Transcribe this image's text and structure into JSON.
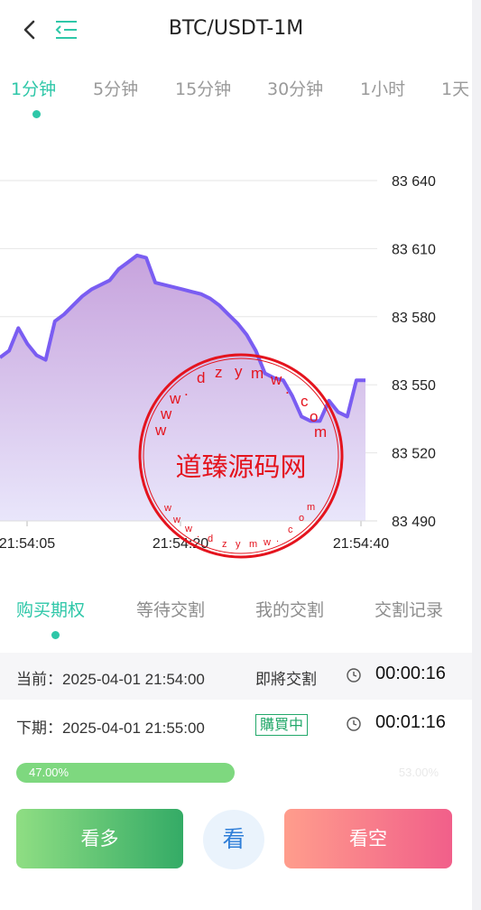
{
  "header": {
    "title": "BTC/USDT-1M",
    "back_icon": "chevron-left-icon",
    "menu_icon": "menu-indent-icon"
  },
  "timeframe_tabs": [
    {
      "label": "1分钟",
      "active": true
    },
    {
      "label": "5分钟",
      "active": false
    },
    {
      "label": "15分钟",
      "active": false
    },
    {
      "label": "30分钟",
      "active": false
    },
    {
      "label": "1小时",
      "active": false
    },
    {
      "label": "1天",
      "active": false
    }
  ],
  "chart_data": {
    "type": "area",
    "title": "",
    "xlabel": "",
    "ylabel": "",
    "y_ticks": [
      "83 640",
      "83 610",
      "83 580",
      "83 550",
      "83 520",
      "83 490"
    ],
    "x_ticks": [
      "21:54:05",
      "21:54:20",
      "21:54:40"
    ],
    "ylim": [
      83490,
      83640
    ],
    "axis_position": "right",
    "grid": true,
    "line_color": "#7a5df2",
    "fill_color_top": "#c7a3dd",
    "fill_color_bottom": "#e9e6fb",
    "series": [
      {
        "x": [
          0,
          1,
          2,
          3,
          4,
          5,
          6,
          7,
          8,
          9,
          10,
          11,
          12,
          13,
          14,
          15,
          16,
          17,
          18,
          19,
          20,
          21,
          22,
          23,
          24,
          25,
          26,
          27,
          28,
          29,
          30,
          31,
          32,
          33,
          34,
          35,
          36,
          37,
          38,
          39,
          40
        ],
        "values": [
          83562,
          83565,
          83575,
          83568,
          83563,
          83561,
          83578,
          83581,
          83585,
          83589,
          83592,
          83594,
          83596,
          83601,
          83604,
          83607,
          83606,
          83595,
          83594,
          83593,
          83592,
          83591,
          83590,
          83588,
          83585,
          83581,
          83577,
          83572,
          83565,
          83555,
          83553,
          83552,
          83545,
          83536,
          83534,
          83534,
          83543,
          83538,
          83536,
          83552,
          83552
        ]
      }
    ]
  },
  "watermark": {
    "text": "道臻源码网",
    "ring_text": "www.dzymw.com"
  },
  "order_tabs": [
    {
      "label": "购买期权",
      "active": true
    },
    {
      "label": "等待交割",
      "active": false
    },
    {
      "label": "我的交割",
      "active": false
    },
    {
      "label": "交割记录",
      "active": false
    }
  ],
  "current_period": {
    "text": "当前：2025-04-01 21:54:00",
    "status": "即將交割",
    "countdown": "00:00:16"
  },
  "next_period": {
    "text": "下期：2025-04-01 21:55:00",
    "status": "購買中",
    "countdown": "00:01:16"
  },
  "ratio": {
    "long_pct": "47.00%",
    "long_value": 0.47,
    "short_pct": "53.00%",
    "long_color": "#7ed87f"
  },
  "actions": {
    "long_label": "看多",
    "middle_label": "看",
    "short_label": "看空"
  }
}
